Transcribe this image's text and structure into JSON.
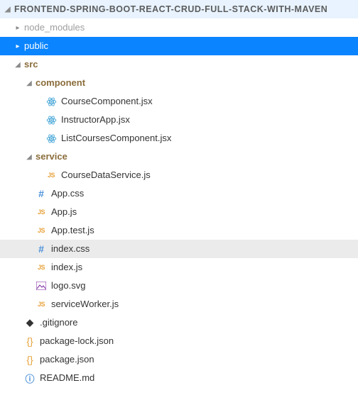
{
  "root": {
    "name": "FRONTEND-SPRING-BOOT-REACT-CRUD-FULL-STACK-WITH-MAVEN"
  },
  "node_modules": {
    "name": "node_modules"
  },
  "public": {
    "name": "public"
  },
  "src": {
    "name": "src"
  },
  "component": {
    "name": "component"
  },
  "course_comp": {
    "name": "CourseComponent.jsx"
  },
  "instructor": {
    "name": "InstructorApp.jsx"
  },
  "list_courses": {
    "name": "ListCoursesComponent.jsx"
  },
  "service": {
    "name": "service"
  },
  "course_data": {
    "name": "CourseDataService.js"
  },
  "app_css": {
    "name": "App.css"
  },
  "app_js": {
    "name": "App.js"
  },
  "app_test": {
    "name": "App.test.js"
  },
  "index_css": {
    "name": "index.css"
  },
  "index_js": {
    "name": "index.js"
  },
  "logo_svg": {
    "name": "logo.svg"
  },
  "sw_js": {
    "name": "serviceWorker.js"
  },
  "gitignore": {
    "name": ".gitignore"
  },
  "pkg_lock": {
    "name": "package-lock.json"
  },
  "pkg": {
    "name": "package.json"
  },
  "readme": {
    "name": "README.md"
  }
}
